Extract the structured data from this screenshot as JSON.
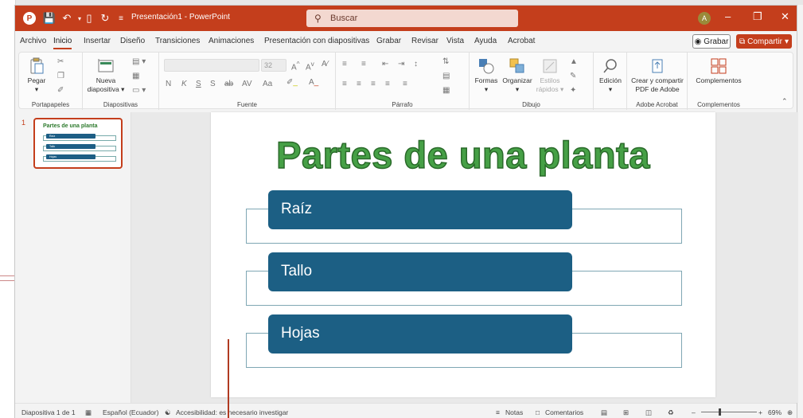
{
  "app": {
    "title": "Presentación1 - PowerPoint",
    "search_placeholder": "Buscar",
    "avatar_initial": "A"
  },
  "menu": {
    "tabs": [
      "Archivo",
      "Inicio",
      "Insertar",
      "Diseño",
      "Transiciones",
      "Animaciones",
      "Presentación con diapositivas",
      "Grabar",
      "Revisar",
      "Vista",
      "Ayuda",
      "Acrobat"
    ],
    "active": "Inicio",
    "record_label": "Grabar",
    "share_label": "Compartir"
  },
  "ribbon": {
    "groups": {
      "clipboard": "Portapapeles",
      "slides": "Diapositivas",
      "font": "Fuente",
      "paragraph": "Párrafo",
      "drawing": "Dibujo",
      "acrobat": "Adobe Acrobat",
      "addins": "Complementos"
    },
    "paste": "Pegar",
    "new_slide_1": "Nueva",
    "new_slide_2": "diapositiva",
    "font_size": "32",
    "shapes": "Formas",
    "arrange": "Organizar",
    "quick_styles_1": "Estilos",
    "quick_styles_2": "rápidos",
    "editing": "Edición",
    "acrobat_1": "Crear y compartir",
    "acrobat_2": "PDF de Adobe",
    "addins_btn": "Complementos",
    "font_buttons": [
      "N",
      "K",
      "S",
      "S",
      "ab",
      "AV",
      "Aa"
    ]
  },
  "thumbnail": {
    "number": "1",
    "title": "Partes de una planta",
    "items": [
      "Raíz",
      "Tallo",
      "Hojas"
    ]
  },
  "slide": {
    "title": "Partes de una planta",
    "items": [
      "Raíz",
      "Tallo",
      "Hojas"
    ],
    "colors": {
      "title_fill": "#46a046",
      "bar": "#1c5f84",
      "box_border": "#7fa7b4"
    }
  },
  "status": {
    "slide_of": "Diapositiva 1 de 1",
    "language": "Español (Ecuador)",
    "accessibility": "Accesibilidad: es necesario investigar",
    "notes": "Notas",
    "comments": "Comentarios",
    "zoom": "69%"
  }
}
